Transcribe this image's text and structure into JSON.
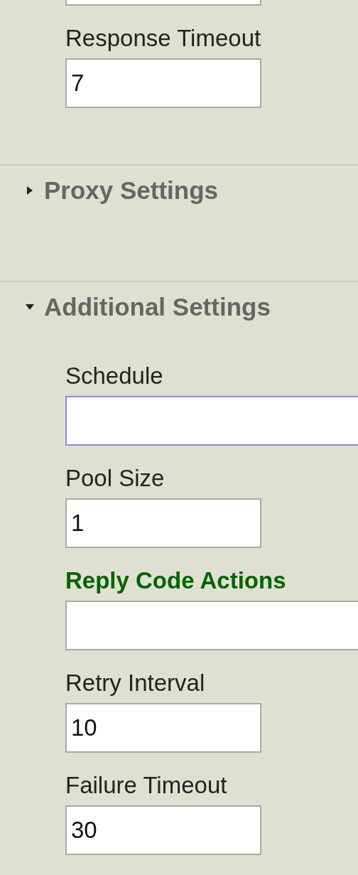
{
  "sections": [
    {
      "kind": "fields",
      "fields": [
        {
          "kind": "cut"
        },
        {
          "kind": "field",
          "label": "Response Timeout",
          "value": "7",
          "wide": false,
          "focused": false,
          "highlighted": false
        }
      ]
    },
    {
      "kind": "group",
      "title": "Proxy Settings",
      "expanded": false
    },
    {
      "kind": "group",
      "title": "Additional Settings",
      "expanded": true,
      "fields": [
        {
          "kind": "field",
          "label": "Schedule",
          "wide": true,
          "focused": true,
          "highlighted": false
        },
        {
          "kind": "field",
          "label": "Pool Size",
          "value": "1",
          "wide": false,
          "focused": false,
          "highlighted": false
        },
        {
          "kind": "field",
          "label": "Reply Code Actions",
          "wide": true,
          "focused": false,
          "highlighted": true
        },
        {
          "kind": "field",
          "label": "Retry Interval",
          "value": "10",
          "wide": false,
          "focused": false,
          "highlighted": false
        },
        {
          "kind": "field",
          "label": "Failure Timeout",
          "value": "30",
          "wide": false,
          "focused": false,
          "highlighted": false
        }
      ]
    }
  ]
}
